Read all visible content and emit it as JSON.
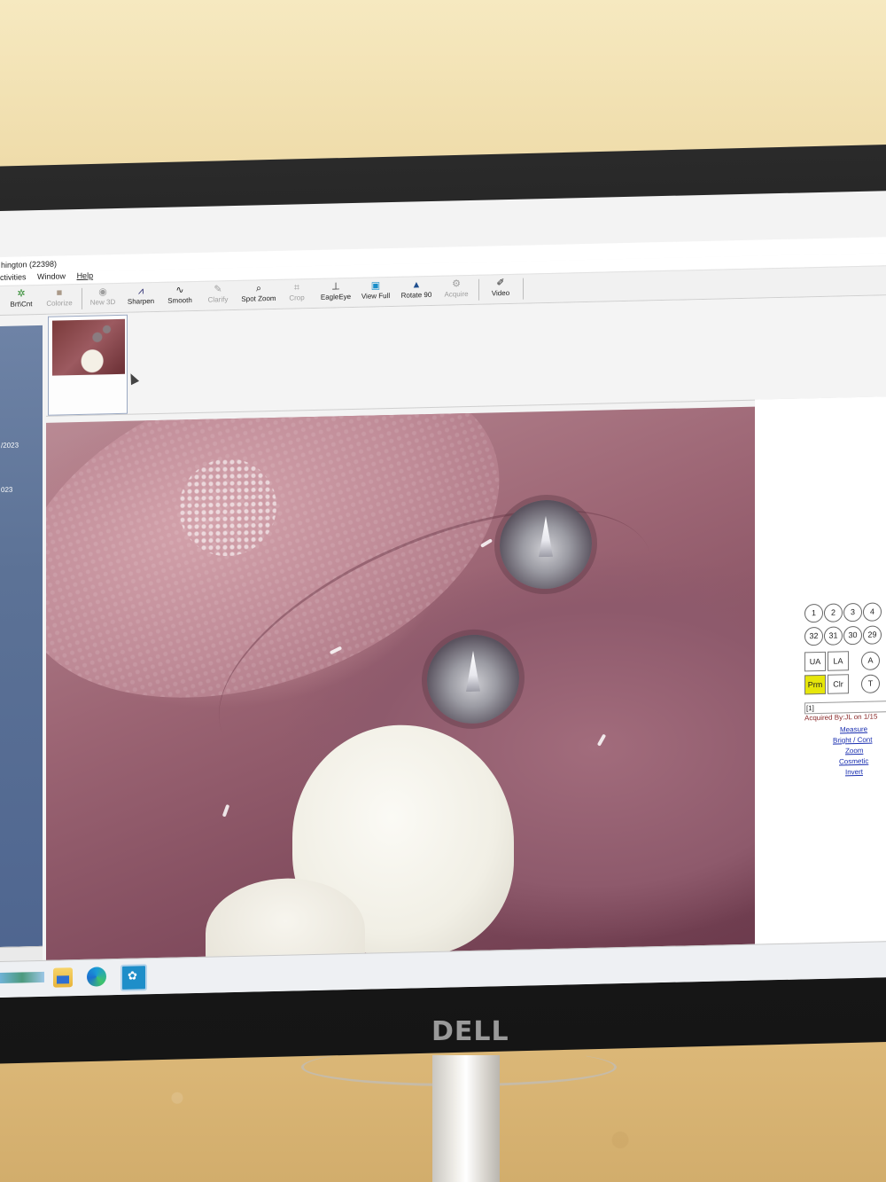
{
  "window": {
    "title": "hington (22398)"
  },
  "menu": {
    "items": [
      "ctivities",
      "Window",
      "Help"
    ]
  },
  "toolbar": {
    "buttons": [
      {
        "label": "Brt\\Cnt",
        "icon": "brightness-icon",
        "enabled": true
      },
      {
        "label": "Colorize",
        "icon": "colorize-icon",
        "enabled": false
      },
      {
        "label": "New 3D",
        "icon": "new-3d-icon",
        "enabled": false
      },
      {
        "label": "Sharpen",
        "icon": "sharpen-icon",
        "enabled": true
      },
      {
        "label": "Smooth",
        "icon": "smooth-icon",
        "enabled": true
      },
      {
        "label": "Clarify",
        "icon": "clarify-icon",
        "enabled": false
      },
      {
        "label": "Spot Zoom",
        "icon": "spot-zoom-icon",
        "enabled": true
      },
      {
        "label": "Crop",
        "icon": "crop-icon",
        "enabled": false
      },
      {
        "label": "EagleEye",
        "icon": "eagle-eye-icon",
        "enabled": true
      },
      {
        "label": "View Full",
        "icon": "view-full-icon",
        "enabled": true
      },
      {
        "label": "Rotate 90",
        "icon": "rotate-icon",
        "enabled": true
      },
      {
        "label": "Acquire",
        "icon": "acquire-icon",
        "enabled": false
      },
      {
        "label": "Video",
        "icon": "video-icon",
        "enabled": true
      }
    ]
  },
  "leftpane": {
    "dates": [
      "/2023",
      "023"
    ]
  },
  "teeth": {
    "upper_row": [
      "1",
      "2",
      "3",
      "4"
    ],
    "lower_row": [
      "32",
      "31",
      "30",
      "29"
    ],
    "arch_buttons": [
      "UA",
      "LA"
    ],
    "letter_buttons": [
      "A",
      "T"
    ],
    "prm_label": "Prm",
    "clr_label": "Clr"
  },
  "info": {
    "field_value": "[1]",
    "acquired_text": "Acquired By:JL on 1/15"
  },
  "tools": {
    "links": [
      "Measure",
      "Bright / Cont",
      "Zoom",
      "Cosmetic",
      "Invert"
    ]
  },
  "monitor": {
    "brand": "DELL"
  },
  "colors": {
    "highlight_button": "#e6e60a",
    "link": "#1a2fb0",
    "acquired_text": "#8a2a2a",
    "left_panel": "#5c7296"
  }
}
